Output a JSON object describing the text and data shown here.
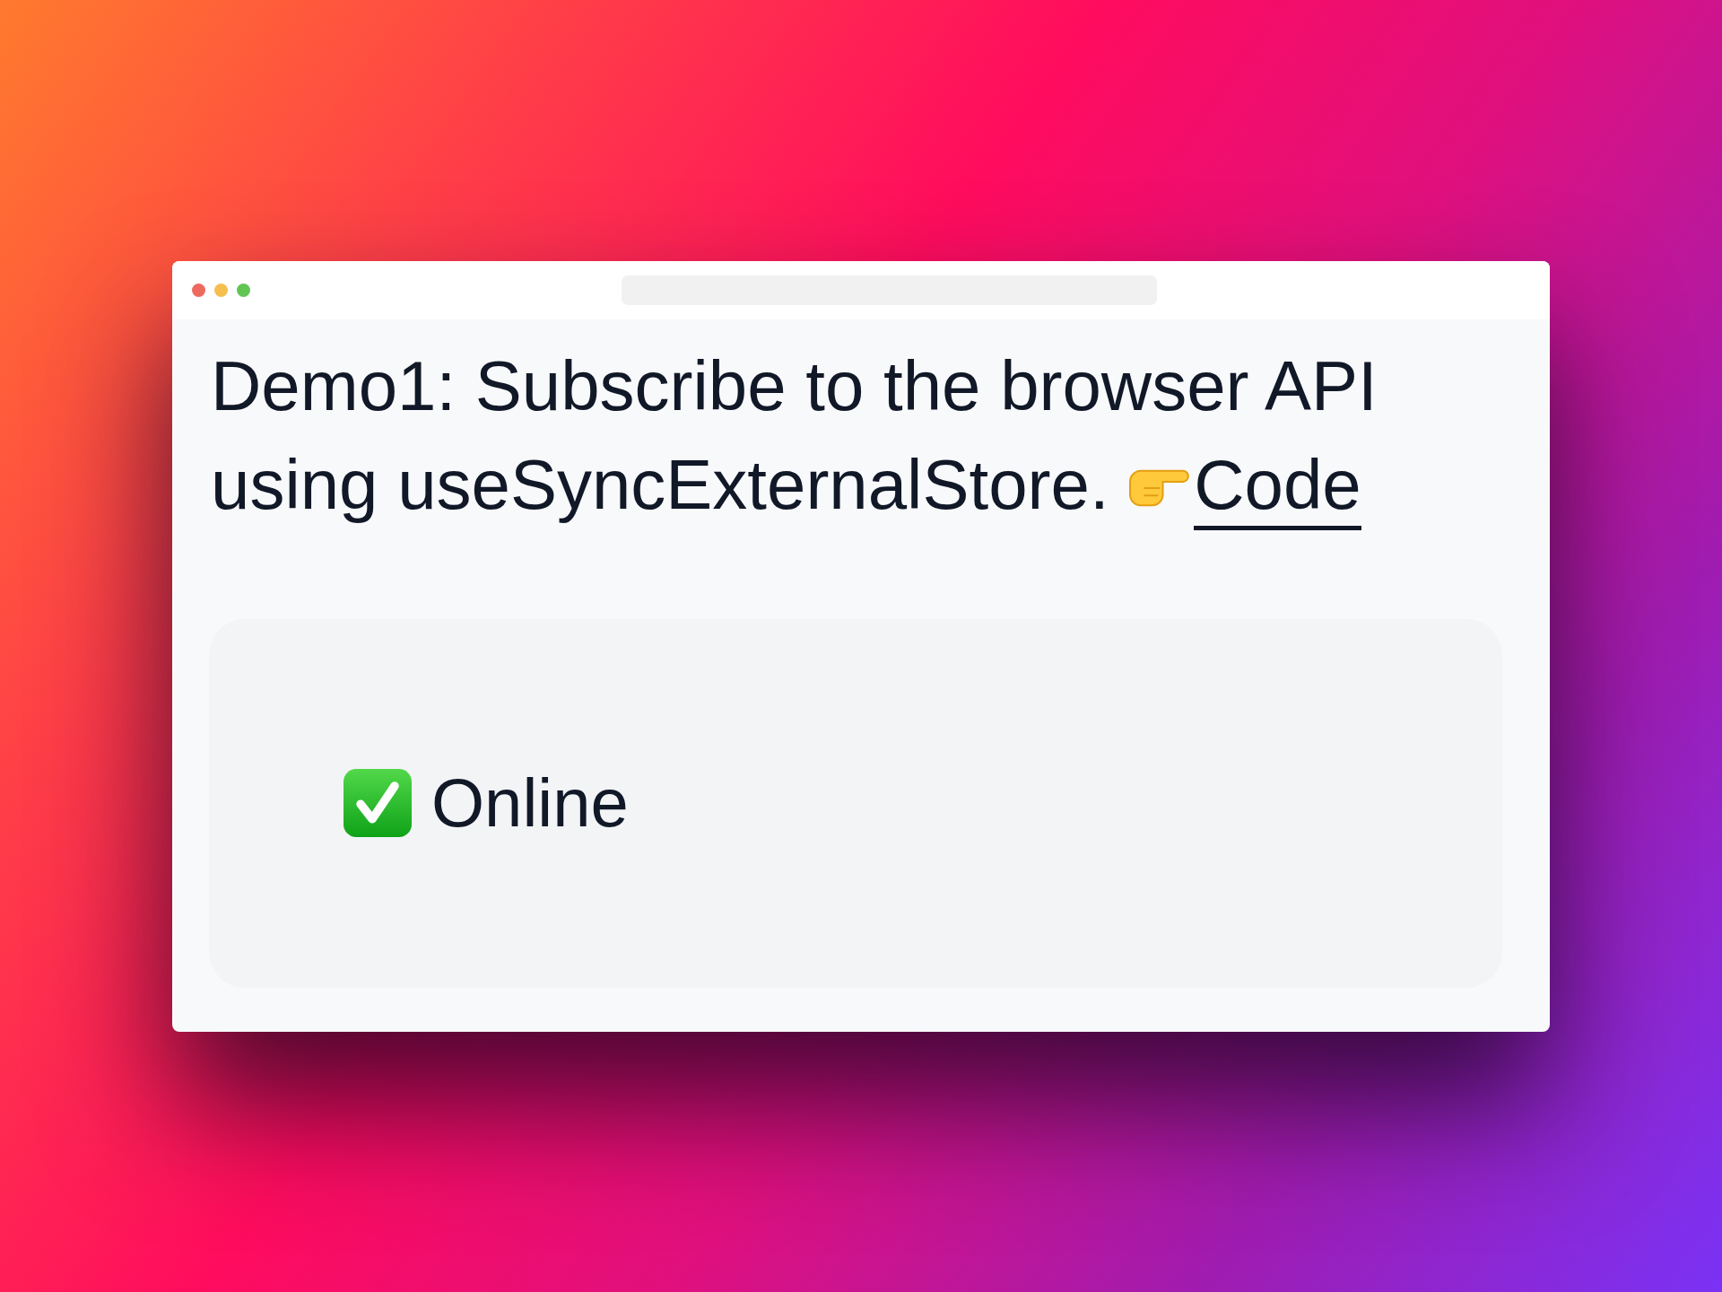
{
  "heading": {
    "text": "Demo1: Subscribe to the browser API using useSyncExternalStore.",
    "link": "Code"
  },
  "status_card": {
    "label": "Online",
    "online": true
  }
}
